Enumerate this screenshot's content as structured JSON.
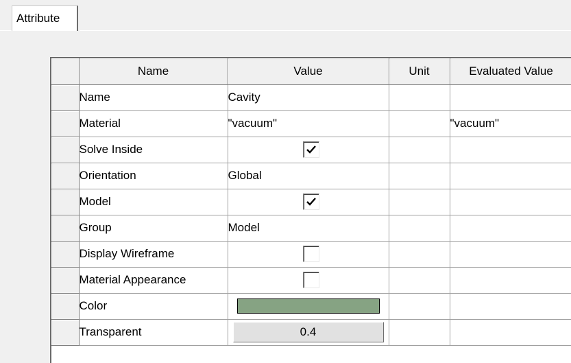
{
  "tabs": [
    {
      "label": "Attribute",
      "active": true
    }
  ],
  "grid": {
    "columns": [
      "Name",
      "Value",
      "Unit",
      "Evaluated Value"
    ],
    "rows": [
      {
        "name": "Name",
        "value": "Cavity",
        "value_type": "text",
        "unit": "",
        "evaluated": ""
      },
      {
        "name": "Material",
        "value": "\"vacuum\"",
        "value_type": "text",
        "unit": "",
        "evaluated": "\"vacuum\""
      },
      {
        "name": "Solve Inside",
        "value": true,
        "value_type": "checkbox",
        "unit": "",
        "evaluated": ""
      },
      {
        "name": "Orientation",
        "value": "Global",
        "value_type": "text",
        "unit": "",
        "evaluated": ""
      },
      {
        "name": "Model",
        "value": true,
        "value_type": "checkbox",
        "unit": "",
        "evaluated": ""
      },
      {
        "name": "Group",
        "value": "Model",
        "value_type": "text",
        "unit": "",
        "evaluated": ""
      },
      {
        "name": "Display Wireframe",
        "value": false,
        "value_type": "checkbox",
        "unit": "",
        "evaluated": ""
      },
      {
        "name": "Material Appearance",
        "value": false,
        "value_type": "checkbox",
        "unit": "",
        "evaluated": ""
      },
      {
        "name": "Color",
        "value": "#86a383",
        "value_type": "color",
        "unit": "",
        "evaluated": ""
      },
      {
        "name": "Transparent",
        "value": "0.4",
        "value_type": "button",
        "unit": "",
        "evaluated": ""
      }
    ]
  },
  "icons": {
    "check": "checkmark-icon"
  }
}
